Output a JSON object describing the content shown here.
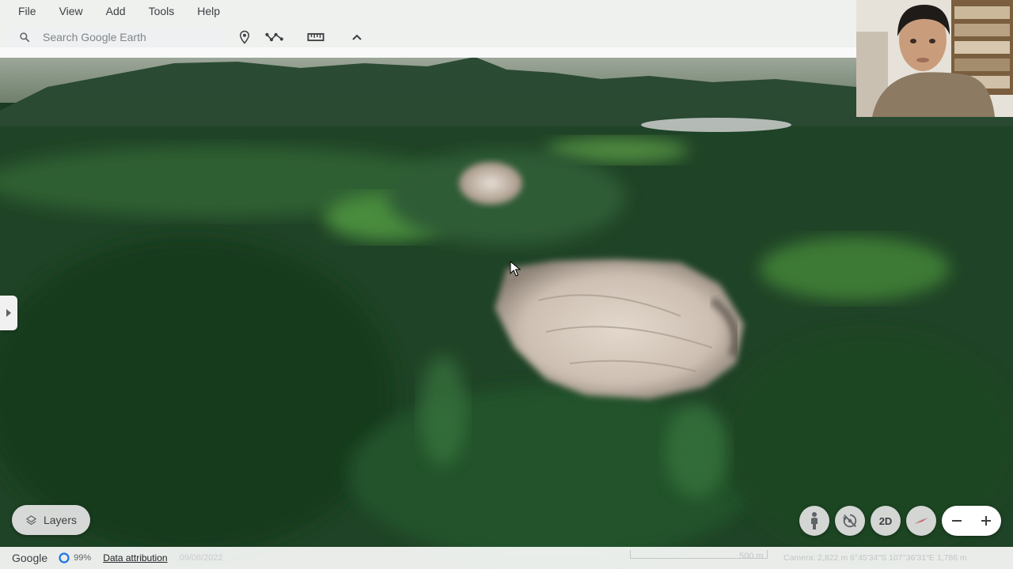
{
  "menu": {
    "items": [
      {
        "label": "File"
      },
      {
        "label": "View"
      },
      {
        "label": "Add"
      },
      {
        "label": "Tools"
      },
      {
        "label": "Help"
      }
    ]
  },
  "search": {
    "placeholder": "Search Google Earth"
  },
  "toolbar": {
    "icons": [
      "placemark-icon",
      "path-icon",
      "ruler-icon",
      "collapse-icon"
    ]
  },
  "layers": {
    "label": "Layers",
    "icon": "layers-icon"
  },
  "nav": {
    "pegman_icon": "pegman-icon",
    "orbit_icon": "orbit-off-icon",
    "view_2d_label": "2D",
    "compass_icon": "compass-icon",
    "zoom_out_icon": "minus-icon",
    "zoom_in_icon": "plus-icon"
  },
  "status": {
    "logo": "Google",
    "progress": "99%",
    "progress_fraction": 0.99,
    "data_attribution": "Data attribution",
    "imagery_date": "09/08/2022",
    "scale": "500 m",
    "camera": "Camera: 2,822 m   6°45'34\"S 107°36'31\"E   1,786 m"
  },
  "colors": {
    "toolbar_bg": "#ffffff",
    "progress_ring": "#1a73e8",
    "compass_needle": "#e53935",
    "forest": "#1f4a28",
    "crater": "#d8ccc0"
  }
}
